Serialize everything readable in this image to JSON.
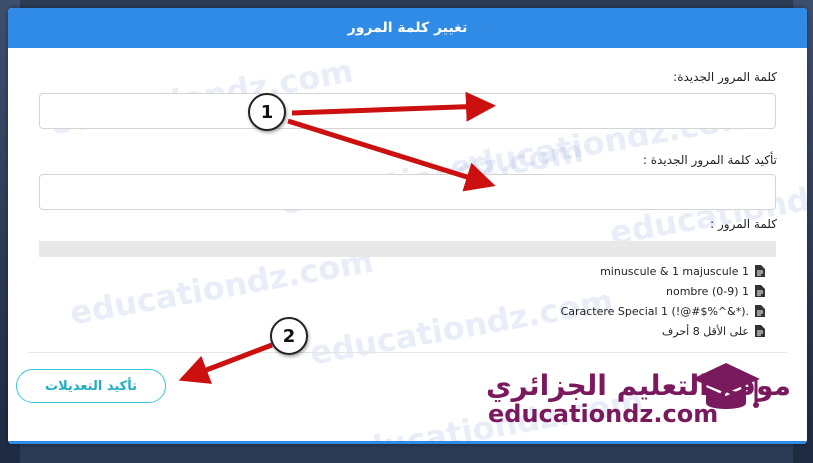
{
  "dialog": {
    "title": "تغيير كلمة المرور",
    "new_password_label": "كلمة المرور الجديدة:",
    "confirm_password_label": "تأكيد كلمة المرور الجديدة :",
    "strength_label": "كلمة المرور :",
    "rules": [
      "minuscule & 1 majuscule 1",
      "nombre (0-9) 1",
      "Caractere Special 1 (!@#$%^&*).",
      "على الأقل 8 أحرف"
    ],
    "confirm_button": "تأكيد التعديلات"
  },
  "annotations": {
    "marker1": "1",
    "marker2": "2"
  },
  "branding": {
    "logo_arabic": "موقع التعليم الجزائري",
    "logo_latin": "educationdz.com",
    "watermark": "educationdz.com"
  },
  "colors": {
    "header": "#2f8be6",
    "button_border": "#3ac7d8",
    "arrow": "#cc0f0f",
    "logo": "#7a1a5e"
  },
  "icons": {
    "rule_icon": "document-icon",
    "logo_icon": "graduation-cap-icon"
  }
}
